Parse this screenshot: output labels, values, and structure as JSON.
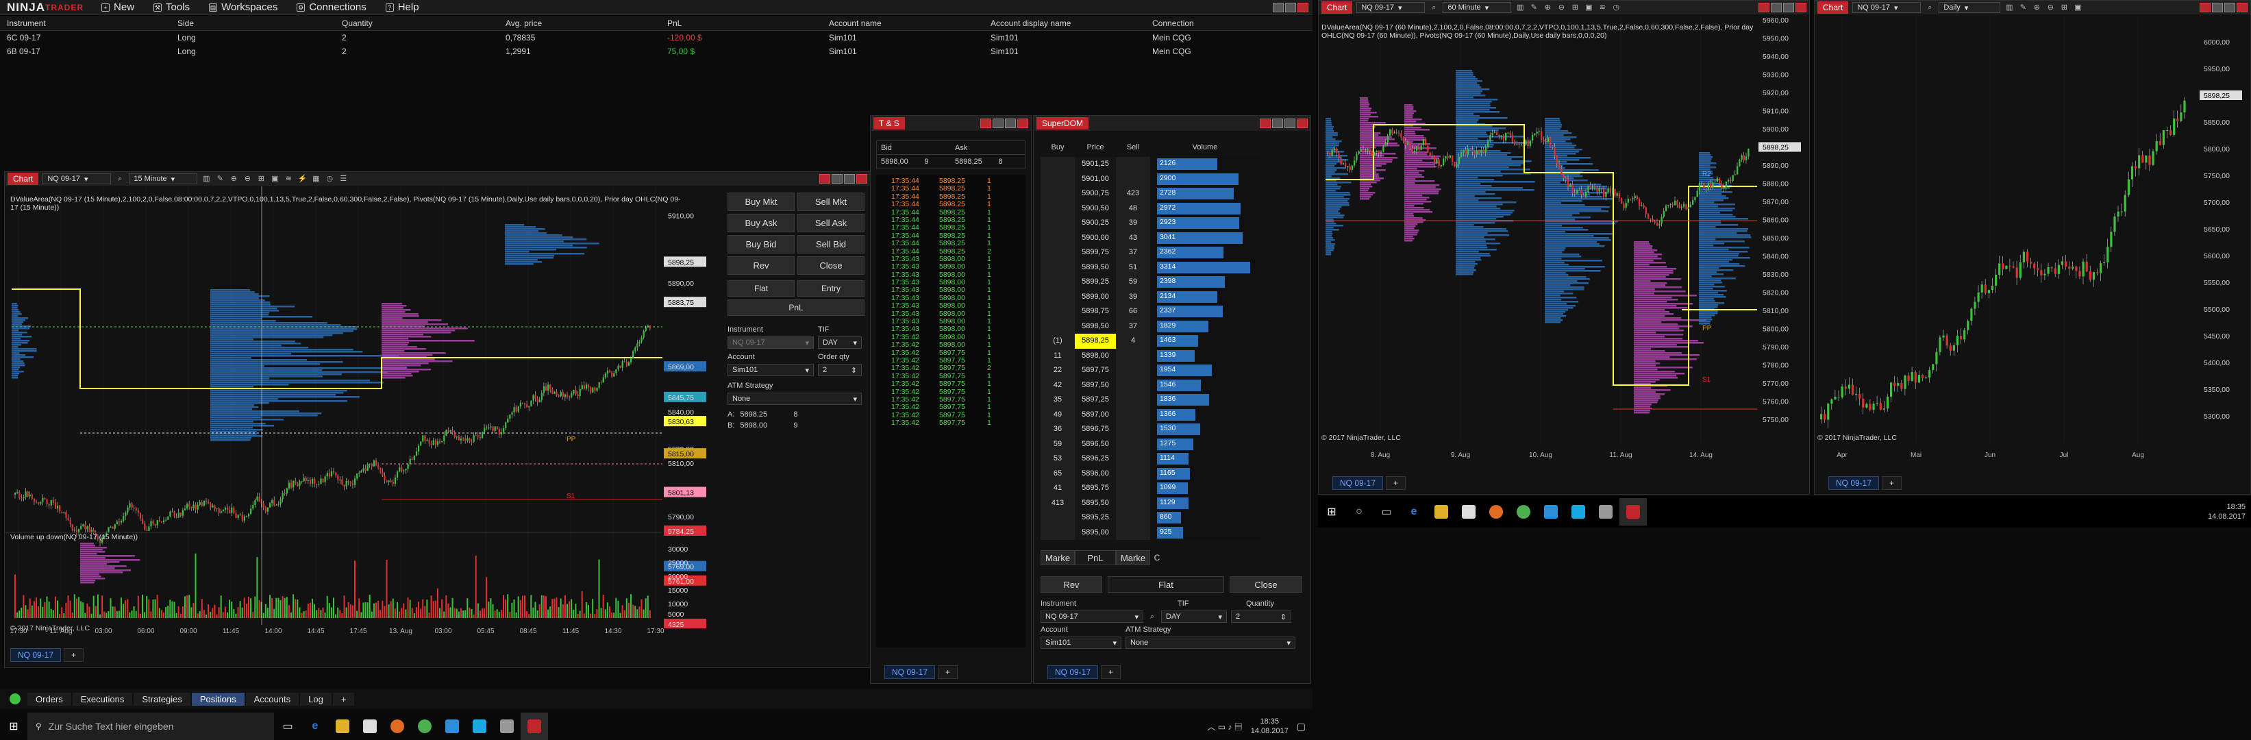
{
  "menu": {
    "logo_a": "NINJA",
    "logo_b": "TRADER",
    "items": [
      "New",
      "Tools",
      "Workspaces",
      "Connections",
      "Help"
    ]
  },
  "positions": {
    "columns": [
      "Instrument",
      "Side",
      "Quantity",
      "Avg. price",
      "PnL",
      "Account name",
      "Account display name",
      "Connection"
    ],
    "rows": [
      [
        "6C 09-17",
        "Long",
        "2",
        "0,78835",
        "-120,00 $",
        "Sim101",
        "Sim101",
        "Mein CQG"
      ],
      [
        "6B 09-17",
        "Long",
        "2",
        "1,2991",
        "75,00 $",
        "Sim101",
        "Sim101",
        "Mein CQG"
      ]
    ]
  },
  "chart1": {
    "tag": "Chart",
    "instrument": "NQ 09-17",
    "period": "15 Minute",
    "indicator_text": "DValueArea(NQ 09-17 (15 Minute),2,100,2,0,False,08:00:00,0,7,2,2,VTPO,0,100,1,13,5,True,2,False,0,60,300,False,2,False), Pivots(NQ 09-17 (15 Minute),Daily,Use daily bars,0,0,0,20), Prior day OHLC(NQ 09-17 (15 Minute))",
    "volume_label": "Volume up down(NQ 09-17 (15 Minute))",
    "copyright": "© 2017 NinjaTrader, LLC",
    "time_labels": [
      "17:30",
      "11. Aug",
      "03:00",
      "06:00",
      "09:00",
      "11:45",
      "14:00",
      "14:45",
      "17:45",
      "13. Aug",
      "03:00",
      "05:45",
      "08:45",
      "11:45",
      "14:30",
      "17:30"
    ],
    "price_ticks": [
      "5910,00",
      "5898,25",
      "5890,00",
      "5883,75",
      "5869,00",
      "5845,75",
      "5840,00",
      "5830,63",
      "5820,00",
      "5815,00",
      "5810,00",
      "5801,13",
      "5790,00",
      "5784,25",
      "5769,00",
      "5761,00"
    ],
    "vol_ticks": [
      "30000",
      "25000",
      "20000",
      "15000",
      "10000",
      "5000",
      "4325"
    ],
    "levels": {
      "pp": "PP",
      "s1": "S1"
    },
    "tab": "NQ 09-17",
    "chart_data": {
      "type": "candlestick",
      "x_ticks": [
        "17:30",
        "11. Aug",
        "03:00",
        "06:00",
        "09:00",
        "11:45",
        "14:00",
        "14:45",
        "17:45",
        "13. Aug",
        "03:00",
        "05:45",
        "08:45",
        "11:45",
        "14:30",
        "17:30"
      ],
      "y_ticks": [
        "5790,00",
        "5810,00",
        "5820,00",
        "5840,00",
        "5890,00",
        "5910,00"
      ],
      "markers": [
        "5898,25",
        "5883,75",
        "5869,00",
        "5845,75",
        "5830,63",
        "5815,00",
        "5801,13",
        "5784,25",
        "5769,00",
        "5761,00"
      ]
    }
  },
  "order_panel": {
    "buy_mkt": "Buy Mkt",
    "sell_mkt": "Sell Mkt",
    "buy_ask": "Buy Ask",
    "sell_ask": "Sell Ask",
    "buy_bid": "Buy Bid",
    "sell_bid": "Sell Bid",
    "rev": "Rev",
    "close": "Close",
    "flat": "Flat",
    "entry": "Entry",
    "pnl": "PnL",
    "instrument_label": "Instrument",
    "tif_label": "TIF",
    "instrument": "NQ 09-17",
    "tif": "DAY",
    "account_label": "Account",
    "qty_label": "Order qty",
    "account": "Sim101",
    "qty": "2",
    "atm_label": "ATM Strategy",
    "atm": "None",
    "a_label": "A:",
    "a_price": "5898,25",
    "a_qty": "8",
    "b_label": "B:",
    "b_price": "5898,00",
    "b_qty": "9"
  },
  "ts": {
    "title": "T & S",
    "bid_h": "Bid",
    "ask_h": "Ask",
    "bid": "5898,00",
    "bid_sz": "9",
    "ask": "5898,25",
    "ask_sz": "8",
    "tab": "NQ 09-17",
    "rows": [
      [
        "17:35:44",
        "5898,25",
        "1",
        "o"
      ],
      [
        "17:35:44",
        "5898,25",
        "1",
        "o"
      ],
      [
        "17:35:44",
        "5898,25",
        "1",
        "o"
      ],
      [
        "17:35:44",
        "5898,25",
        "1",
        "o"
      ],
      [
        "17:35:44",
        "5898,25",
        "1",
        "g"
      ],
      [
        "17:35:44",
        "5898,25",
        "1",
        "g"
      ],
      [
        "17:35:44",
        "5898,25",
        "1",
        "g"
      ],
      [
        "17:35:44",
        "5898,25",
        "1",
        "g"
      ],
      [
        "17:35:44",
        "5898,25",
        "1",
        "g"
      ],
      [
        "17:35:44",
        "5898,25",
        "2",
        "g"
      ],
      [
        "17:35:43",
        "5898,00",
        "1",
        "g"
      ],
      [
        "17:35:43",
        "5898,00",
        "1",
        "g"
      ],
      [
        "17:35:43",
        "5898,00",
        "1",
        "g"
      ],
      [
        "17:35:43",
        "5898,00",
        "1",
        "g"
      ],
      [
        "17:35:43",
        "5898,00",
        "1",
        "g"
      ],
      [
        "17:35:43",
        "5898,00",
        "1",
        "g"
      ],
      [
        "17:35:43",
        "5898,00",
        "1",
        "g"
      ],
      [
        "17:35:43",
        "5898,00",
        "1",
        "g"
      ],
      [
        "17:35:43",
        "5898,00",
        "1",
        "g"
      ],
      [
        "17:35:43",
        "5898,00",
        "1",
        "g"
      ],
      [
        "17:35:42",
        "5898,00",
        "1",
        "g"
      ],
      [
        "17:35:42",
        "5898,00",
        "1",
        "g"
      ],
      [
        "17:35:42",
        "5897,75",
        "1",
        "g"
      ],
      [
        "17:35:42",
        "5897,75",
        "1",
        "g"
      ],
      [
        "17:35:42",
        "5897,75",
        "2",
        "g"
      ],
      [
        "17:35:42",
        "5897,75",
        "1",
        "g"
      ],
      [
        "17:35:42",
        "5897,75",
        "1",
        "g"
      ],
      [
        "17:35:42",
        "5897,75",
        "1",
        "g"
      ],
      [
        "17:35:42",
        "5897,75",
        "1",
        "g"
      ],
      [
        "17:35:42",
        "5897,75",
        "1",
        "g"
      ],
      [
        "17:35:42",
        "5897,75",
        "1",
        "g"
      ],
      [
        "17:35:42",
        "5897,75",
        "1",
        "g"
      ]
    ]
  },
  "dom": {
    "title": "SuperDOM",
    "buy_h": "Buy",
    "price_h": "Price",
    "sell_h": "Sell",
    "vol_h": "Volume",
    "pos": "(1)",
    "tab": "NQ 09-17",
    "rows": [
      [
        "",
        "5901,25",
        "",
        "2126"
      ],
      [
        "",
        "5901,00",
        "",
        "2900"
      ],
      [
        "",
        "5900,75",
        "423",
        "2728"
      ],
      [
        "",
        "5900,50",
        "48",
        "2972"
      ],
      [
        "",
        "5900,25",
        "39",
        "2923"
      ],
      [
        "",
        "5900,00",
        "43",
        "3041"
      ],
      [
        "",
        "5899,75",
        "37",
        "2362"
      ],
      [
        "",
        "5899,50",
        "51",
        "3314"
      ],
      [
        "",
        "5899,25",
        "59",
        "2398"
      ],
      [
        "",
        "5899,00",
        "39",
        "2134"
      ],
      [
        "",
        "5898,75",
        "66",
        "2337"
      ],
      [
        "",
        "5898,50",
        "37",
        "1829"
      ],
      [
        "(1)",
        "5898,25",
        "4",
        "1463"
      ],
      [
        "11",
        "5898,00",
        "",
        "1339"
      ],
      [
        "22",
        "5897,75",
        "",
        "1954"
      ],
      [
        "42",
        "5897,50",
        "",
        "1546"
      ],
      [
        "35",
        "5897,25",
        "",
        "1836"
      ],
      [
        "49",
        "5897,00",
        "",
        "1366"
      ],
      [
        "36",
        "5896,75",
        "",
        "1530"
      ],
      [
        "59",
        "5896,50",
        "",
        "1275"
      ],
      [
        "53",
        "5896,25",
        "",
        "1114"
      ],
      [
        "65",
        "5896,00",
        "",
        "1165"
      ],
      [
        "41",
        "5895,75",
        "",
        "1099"
      ],
      [
        "413",
        "5895,50",
        "",
        "1129"
      ],
      [
        "",
        "5895,25",
        "",
        "860"
      ],
      [
        "",
        "5895,00",
        "",
        "925"
      ]
    ],
    "marke_l": "Marke",
    "pnl": "PnL",
    "marke_r": "Marke",
    "c": "C",
    "rev": "Rev",
    "flat": "Flat",
    "close": "Close",
    "instrument_label": "Instrument",
    "tif_label": "TIF",
    "qty_label": "Quantity",
    "instrument": "NQ 09-17",
    "tif": "DAY",
    "qty": "2",
    "account_label": "Account",
    "atm_label": "ATM Strategy",
    "account": "Sim101",
    "atm": "None"
  },
  "bottom": {
    "tabs": [
      "Orders",
      "Executions",
      "Strategies",
      "Positions",
      "Accounts",
      "Log"
    ],
    "active": "Positions"
  },
  "taskbar_left": {
    "search": "Zur Suche Text hier eingeben",
    "time": "18:35",
    "date": "14.08.2017"
  },
  "chart2": {
    "tag": "Chart",
    "instrument": "NQ 09-17",
    "period": "60 Minute",
    "indicator_text": "DValueArea(NQ 09-17 (60 Minute),2,100,2,0,False,08:00:00,0,7,2,2,VTPO,0,100,1,13,5,True,2,False,0,60,300,False,2,False), Prior day OHLC(NQ 09-17 (60 Minute)), Pivots(NQ 09-17 (60 Minute),Daily,Use daily bars,0,0,0,20)",
    "copyright": "© 2017 NinjaTrader, LLC",
    "time_labels": [
      "8. Aug",
      "9. Aug",
      "10. Aug",
      "11. Aug",
      "14. Aug"
    ],
    "price_ticks": [
      "5960,00",
      "5950,00",
      "5940,00",
      "5930,00",
      "5920,00",
      "5910,00",
      "5900,00",
      "5898,25",
      "5890,00",
      "5880,00",
      "5870,00",
      "5860,00",
      "5850,00",
      "5840,00",
      "5830,00",
      "5820,00",
      "5810,00",
      "5800,00",
      "5790,00",
      "5780,00",
      "5770,00",
      "5760,00",
      "5750,00"
    ],
    "r2": "R2",
    "pp": "PP",
    "s1": "S1",
    "tab": "NQ 09-17"
  },
  "chart3": {
    "tag": "Chart",
    "instrument": "NQ 09-17",
    "period": "Daily",
    "copyright": "© 2017 NinjaTrader, LLC",
    "time_labels": [
      "Apr",
      "Mai",
      "Jun",
      "Jul",
      "Aug"
    ],
    "price_ticks": [
      "6000,00",
      "5950,00",
      "5898,25",
      "5850,00",
      "5800,00",
      "5750,00",
      "5700,00",
      "5650,00",
      "5600,00",
      "5550,00",
      "5500,00",
      "5450,00",
      "5400,00",
      "5350,00",
      "5300,00"
    ],
    "tab": "NQ 09-17"
  },
  "taskbar_right": {
    "time": "18:35",
    "date": "14.08.2017"
  },
  "colors": {
    "accent": "#c0262c",
    "up": "#3bc43b",
    "down": "#e03030",
    "profile": "#2a6eb8",
    "tpo": "#b044b0",
    "yellow": "#ffff3a",
    "highlight": "#ffff00"
  }
}
